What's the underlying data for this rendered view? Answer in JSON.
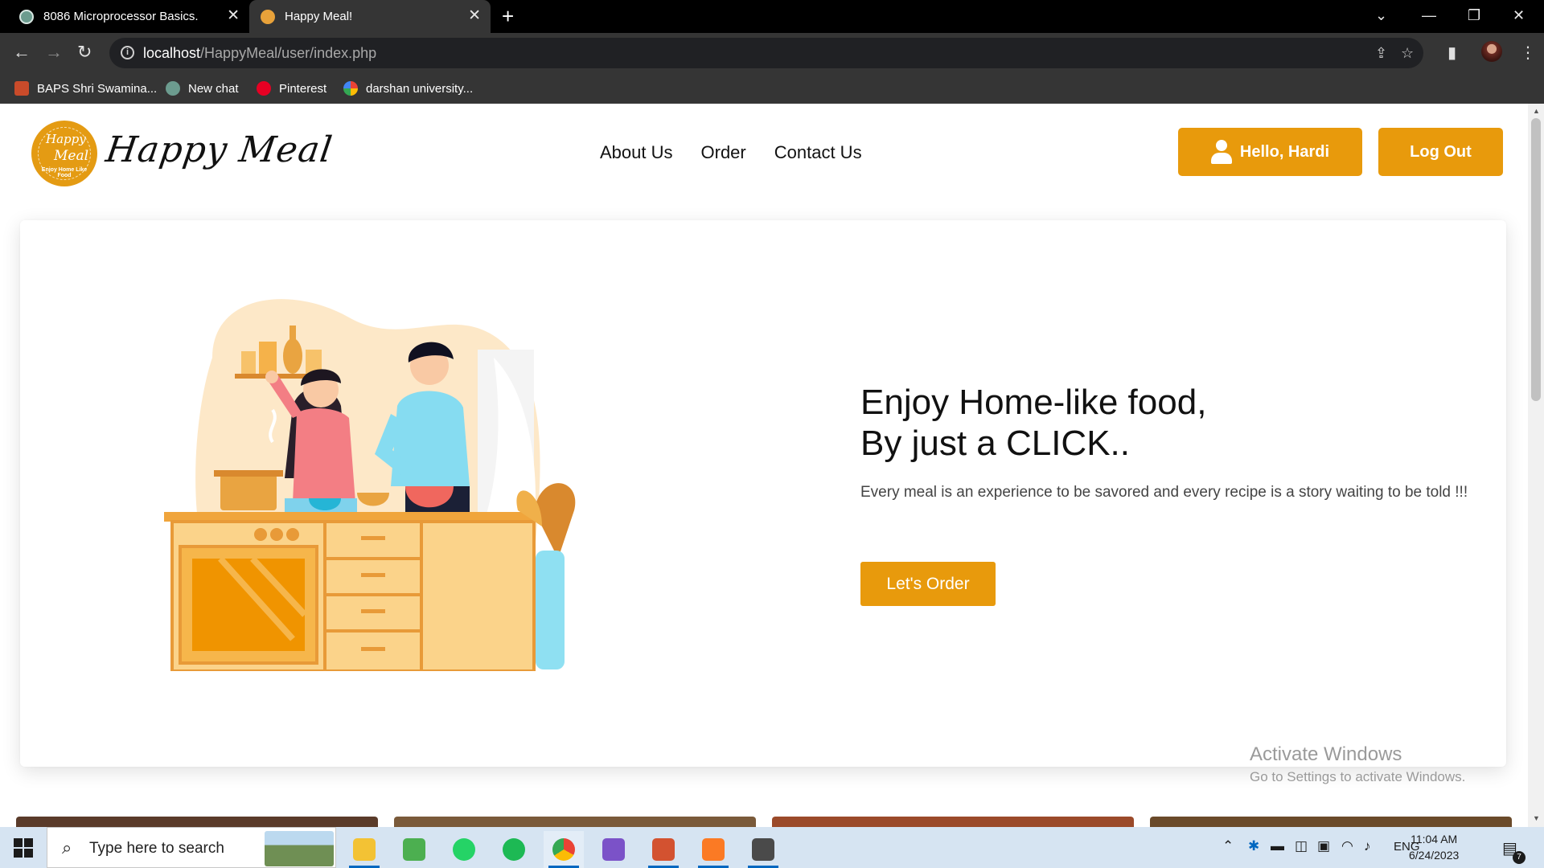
{
  "browser": {
    "tabs": [
      {
        "title": "8086 Microprocessor Basics.",
        "active": false
      },
      {
        "title": "Happy Meal!",
        "active": true
      }
    ],
    "new_tab": "+",
    "url_host": "localhost",
    "url_path": "/HappyMeal/user/index.php",
    "bookmarks": [
      "BAPS Shri Swamina...",
      "New chat",
      "Pinterest",
      "darshan university..."
    ]
  },
  "site": {
    "logo": {
      "line1": "Happy",
      "line2": "Meal",
      "tagline": "Enjoy Home Like Food"
    },
    "brand_name": "Happy Meal",
    "nav": [
      "About Us",
      "Order",
      "Contact Us"
    ],
    "user_greeting": "Hello, Hardi",
    "logout_label": "Log Out"
  },
  "hero": {
    "title_line1": "Enjoy Home-like food,",
    "title_line2": "By just a CLICK..",
    "subtitle": "Every meal is an experience to be savored and every recipe is a story waiting to be told !!!",
    "cta_label": "Let's Order"
  },
  "watermark": {
    "title": "Activate Windows",
    "subtitle": "Go to Settings to activate Windows."
  },
  "taskbar": {
    "search_placeholder": "Type here to search",
    "language": "ENG",
    "time": "11:04 AM",
    "date": "6/24/2023",
    "notification_count": "7"
  },
  "colors": {
    "accent": "#e89a0c",
    "chrome_dark": "#353535",
    "taskbar": "#d6e4f2"
  }
}
